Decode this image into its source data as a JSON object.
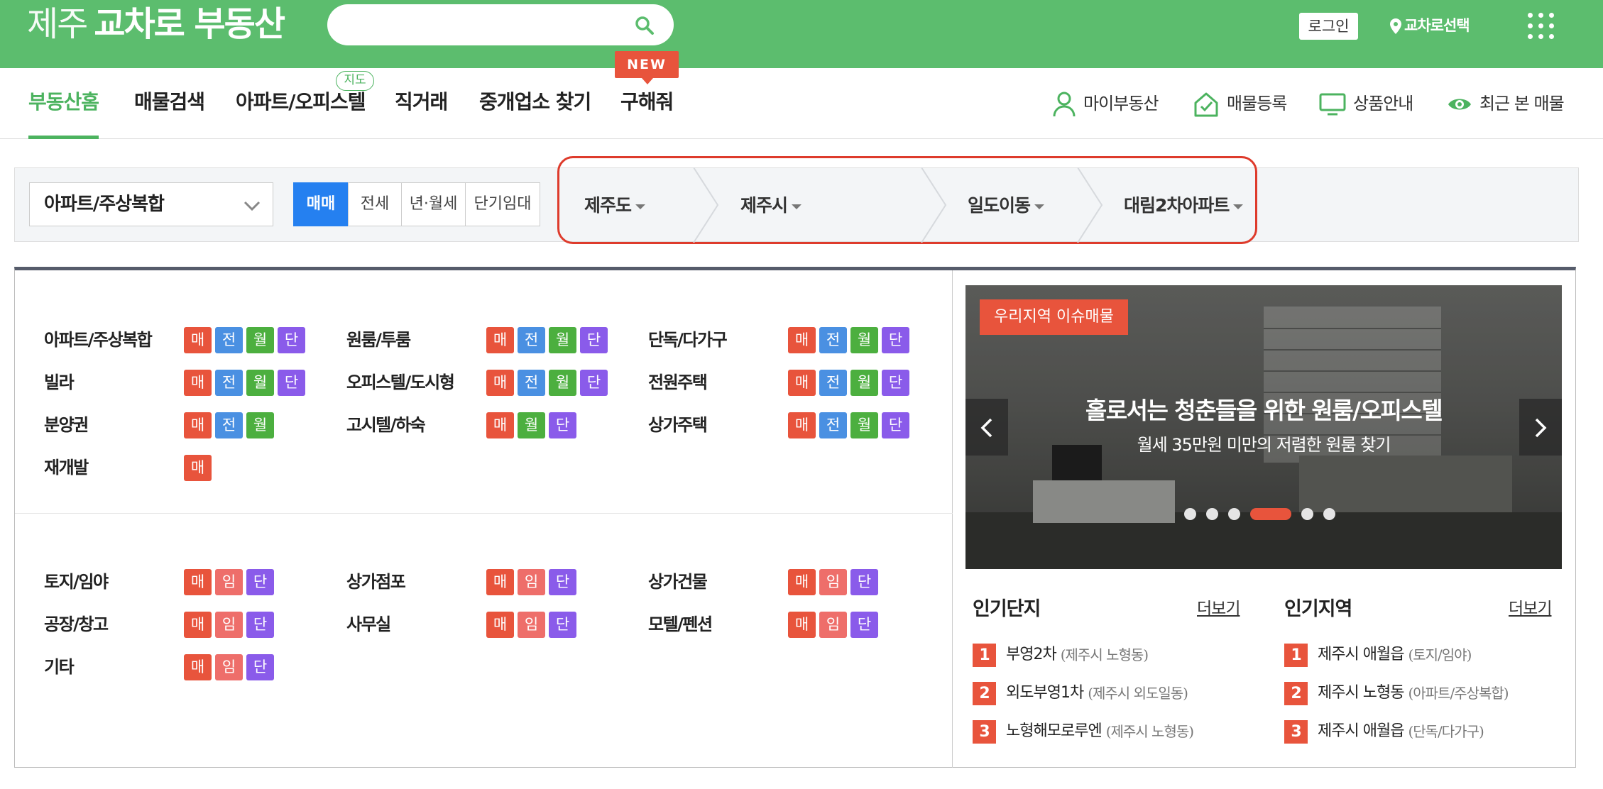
{
  "header": {
    "logo_light": "제주",
    "logo_bold": "교차로 부동산",
    "search_placeholder": "",
    "login_label": "로그인",
    "region_select_label": "교차로선택"
  },
  "nav": {
    "items": [
      "부동산홈",
      "매물검색",
      "아파트/오피스텔",
      "직거래",
      "중개업소 찾기",
      "구해줘"
    ],
    "active_index": 0,
    "map_badge": "지도",
    "new_badge": "NEW",
    "utils": [
      "마이부동산",
      "매물등록",
      "상품안내",
      "최근 본 매물"
    ]
  },
  "filter": {
    "property_type": "아파트/주상복합",
    "deal_tabs": [
      "매매",
      "전세",
      "년·월세",
      "단기임대"
    ],
    "active_deal": 0,
    "locations": [
      "제주도",
      "제주시",
      "일도이동",
      "대림2차아파트"
    ]
  },
  "chip_labels": {
    "mae": "매",
    "jeon": "전",
    "wol": "월",
    "dan": "단",
    "im": "임"
  },
  "categories_residential": [
    {
      "label": "아파트/주상복합",
      "chips": [
        "mae",
        "jeon",
        "wol",
        "dan"
      ]
    },
    {
      "label": "원룸/투룸",
      "chips": [
        "mae",
        "jeon",
        "wol",
        "dan"
      ]
    },
    {
      "label": "단독/다가구",
      "chips": [
        "mae",
        "jeon",
        "wol",
        "dan"
      ]
    },
    {
      "label": "빌라",
      "chips": [
        "mae",
        "jeon",
        "wol",
        "dan"
      ]
    },
    {
      "label": "오피스텔/도시형",
      "chips": [
        "mae",
        "jeon",
        "wol",
        "dan"
      ]
    },
    {
      "label": "전원주택",
      "chips": [
        "mae",
        "jeon",
        "wol",
        "dan"
      ]
    },
    {
      "label": "분양권",
      "chips": [
        "mae",
        "jeon",
        "wol"
      ]
    },
    {
      "label": "고시텔/하숙",
      "chips": [
        "mae",
        "wol",
        "dan"
      ]
    },
    {
      "label": "상가주택",
      "chips": [
        "mae",
        "jeon",
        "wol",
        "dan"
      ]
    },
    {
      "label": "재개발",
      "chips": [
        "mae"
      ]
    }
  ],
  "categories_commercial": [
    {
      "label": "토지/임야",
      "chips": [
        "mae",
        "im",
        "dan"
      ]
    },
    {
      "label": "상가점포",
      "chips": [
        "mae",
        "im",
        "dan"
      ]
    },
    {
      "label": "상가건물",
      "chips": [
        "mae",
        "im",
        "dan"
      ]
    },
    {
      "label": "공장/창고",
      "chips": [
        "mae",
        "im",
        "dan"
      ]
    },
    {
      "label": "사무실",
      "chips": [
        "mae",
        "im",
        "dan"
      ]
    },
    {
      "label": "모텔/펜션",
      "chips": [
        "mae",
        "im",
        "dan"
      ]
    },
    {
      "label": "기타",
      "chips": [
        "mae",
        "im",
        "dan"
      ]
    }
  ],
  "banner": {
    "tag": "우리지역 이슈매물",
    "title": "홀로서는 청춘들을 위한 원룸/오피스텔",
    "subtitle": "월세 35만원 미만의 저렴한 원룸 찾기",
    "slide_count": 6,
    "active_slide": 3
  },
  "popular_complex": {
    "title": "인기단지",
    "more": "더보기",
    "items": [
      {
        "rank": "1",
        "name": "부영2차",
        "sub": "(제주시 노형동)"
      },
      {
        "rank": "2",
        "name": "외도부영1차",
        "sub": "(제주시 외도일동)"
      },
      {
        "rank": "3",
        "name": "노형해모로루엔",
        "sub": "(제주시 노형동)"
      }
    ]
  },
  "popular_region": {
    "title": "인기지역",
    "more": "더보기",
    "items": [
      {
        "rank": "1",
        "name": "제주시 애월읍",
        "sub": "(토지/임야)"
      },
      {
        "rank": "2",
        "name": "제주시 노형동",
        "sub": "(아파트/주상복합)"
      },
      {
        "rank": "3",
        "name": "제주시 애월읍",
        "sub": "(단독/다가구)"
      }
    ]
  },
  "colors": {
    "brand_green": "#5cbd6e",
    "accent_red": "#e8543c",
    "active_blue": "#2580f0",
    "chip_jeon": "#4a90e2",
    "chip_wol": "#4caf3f",
    "chip_dan": "#8a5bea",
    "chip_im": "#ee6e6a"
  }
}
